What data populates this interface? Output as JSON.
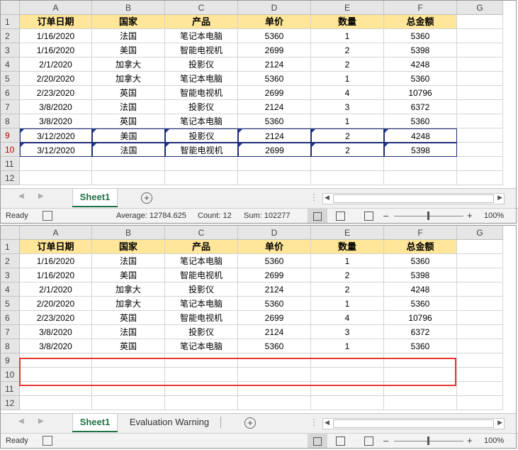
{
  "columns": [
    "A",
    "B",
    "C",
    "D",
    "E",
    "F",
    "G"
  ],
  "header_row": [
    "订单日期",
    "国家",
    "产品",
    "单价",
    "数量",
    "总金额"
  ],
  "rows_full": [
    [
      "1/16/2020",
      "法国",
      "笔记本电脑",
      "5360",
      "1",
      "5360"
    ],
    [
      "1/16/2020",
      "美国",
      "智能电视机",
      "2699",
      "2",
      "5398"
    ],
    [
      "2/1/2020",
      "加拿大",
      "投影仪",
      "2124",
      "2",
      "4248"
    ],
    [
      "2/20/2020",
      "加拿大",
      "笔记本电脑",
      "5360",
      "1",
      "5360"
    ],
    [
      "2/23/2020",
      "英国",
      "智能电视机",
      "2699",
      "4",
      "10796"
    ],
    [
      "3/8/2020",
      "法国",
      "投影仪",
      "2124",
      "3",
      "6372"
    ],
    [
      "3/8/2020",
      "英国",
      "笔记本电脑",
      "5360",
      "1",
      "5360"
    ],
    [
      "3/12/2020",
      "美国",
      "投影仪",
      "2124",
      "2",
      "4248"
    ],
    [
      "3/12/2020",
      "法国",
      "智能电视机",
      "2699",
      "2",
      "5398"
    ]
  ],
  "row_numbers": [
    "1",
    "2",
    "3",
    "4",
    "5",
    "6",
    "7",
    "8",
    "9",
    "10",
    "11",
    "12"
  ],
  "top_pane": {
    "tabs": [
      "Sheet1"
    ],
    "status": {
      "ready": "Ready",
      "average": "Average: 12784.625",
      "count": "Count: 12",
      "sum": "Sum: 102277",
      "zoom": "100%"
    }
  },
  "bottom_pane": {
    "tabs": [
      "Sheet1",
      "Evaluation Warning"
    ],
    "status": {
      "ready": "Ready",
      "zoom": "100%"
    }
  },
  "colors": {
    "header_fill": "#ffe699",
    "selection_border": "#1f2d78",
    "highlight_red": "#e53935",
    "sheet_tab_green": "#217346"
  },
  "icons": [
    "add-sheet-icon",
    "normal-view-icon",
    "page-layout-icon",
    "page-break-icon",
    "zoom-minus-icon",
    "zoom-plus-icon",
    "macro-record-icon"
  ]
}
